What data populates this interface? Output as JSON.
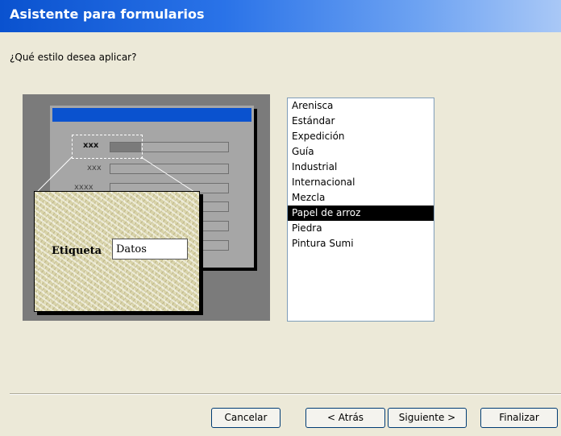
{
  "window": {
    "title": "Asistente para formularios"
  },
  "prompt": "¿Qué estilo desea aplicar?",
  "preview": {
    "rows": [
      "xxx",
      "xxx",
      "xxxx"
    ],
    "sample_label": "Etiqueta",
    "sample_field": "Datos"
  },
  "styles": {
    "items": [
      "Arenisca",
      "Estándar",
      "Expedición",
      "Guía",
      "Industrial",
      "Internacional",
      "Mezcla",
      "Papel de arroz",
      "Piedra",
      "Pintura Sumi"
    ],
    "selected": "Papel de arroz"
  },
  "buttons": {
    "cancel": "Cancelar",
    "back": "< Atrás",
    "next": "Siguiente >",
    "finish": "Finalizar"
  },
  "colors": {
    "title_gradient_start": "#0a52cf",
    "selection_background": "#000000",
    "preview_background": "#7b7b7b"
  }
}
